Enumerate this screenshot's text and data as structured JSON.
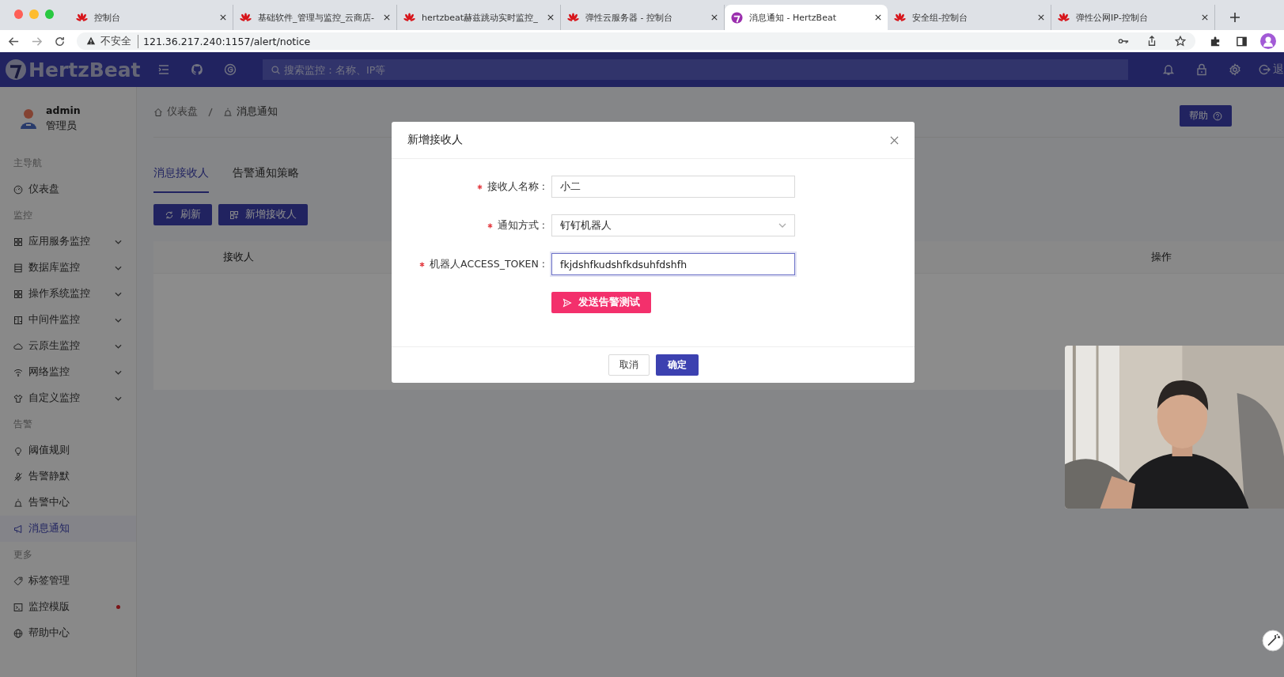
{
  "browser": {
    "tabs": [
      {
        "title": "控制台",
        "selected": false
      },
      {
        "title": "基础软件_管理与监控_云商店-",
        "selected": false
      },
      {
        "title": "hertzbeat赫兹跳动实时监控_",
        "selected": false
      },
      {
        "title": "弹性云服务器 - 控制台",
        "selected": false
      },
      {
        "title": "消息通知 - HertzBeat",
        "selected": true
      },
      {
        "title": "安全组-控制台",
        "selected": false
      },
      {
        "title": "弹性公网IP-控制台",
        "selected": false
      }
    ],
    "address": {
      "security": "不安全",
      "url": "121.36.217.240:1157/alert/notice"
    }
  },
  "header": {
    "logo": "HertzBeat",
    "search_placeholder": "搜索监控：名称、IP等",
    "logout_partial": "退"
  },
  "user": {
    "name": "admin",
    "role": "管理员"
  },
  "sidebar": [
    {
      "title": "主导航",
      "items": [
        {
          "label": "仪表盘",
          "expandable": false,
          "selected": false,
          "dot": false
        }
      ]
    },
    {
      "title": "监控",
      "items": [
        {
          "label": "应用服务监控",
          "expandable": true,
          "selected": false,
          "dot": false
        },
        {
          "label": "数据库监控",
          "expandable": true,
          "selected": false,
          "dot": false
        },
        {
          "label": "操作系统监控",
          "expandable": true,
          "selected": false,
          "dot": false
        },
        {
          "label": "中间件监控",
          "expandable": true,
          "selected": false,
          "dot": false
        },
        {
          "label": "云原生监控",
          "expandable": true,
          "selected": false,
          "dot": false
        },
        {
          "label": "网络监控",
          "expandable": true,
          "selected": false,
          "dot": false
        },
        {
          "label": "自定义监控",
          "expandable": true,
          "selected": false,
          "dot": false
        }
      ]
    },
    {
      "title": "告警",
      "items": [
        {
          "label": "阈值规则",
          "expandable": false,
          "selected": false,
          "dot": false
        },
        {
          "label": "告警静默",
          "expandable": false,
          "selected": false,
          "dot": false
        },
        {
          "label": "告警中心",
          "expandable": false,
          "selected": false,
          "dot": false
        },
        {
          "label": "消息通知",
          "expandable": false,
          "selected": true,
          "dot": false
        }
      ]
    },
    {
      "title": "更多",
      "items": [
        {
          "label": "标签管理",
          "expandable": false,
          "selected": false,
          "dot": false
        },
        {
          "label": "监控模版",
          "expandable": false,
          "selected": false,
          "dot": true
        },
        {
          "label": "帮助中心",
          "expandable": false,
          "selected": false,
          "dot": false
        }
      ]
    }
  ],
  "breadcrumb": [
    "仪表盘",
    "消息通知"
  ],
  "help_button": "帮助",
  "page_tabs": [
    {
      "label": "消息接收人",
      "selected": true
    },
    {
      "label": "告警通知策略",
      "selected": false
    }
  ],
  "toolbar": [
    "刷新",
    "新增接收人"
  ],
  "table": {
    "columns": [
      "接收人",
      "操作"
    ]
  },
  "modal": {
    "title": "新增接收人",
    "fields": [
      {
        "label": "接收人名称 :",
        "required": true,
        "kind": "input",
        "value": "小二",
        "focused": false
      },
      {
        "label": "通知方式 :",
        "required": true,
        "kind": "select",
        "value": "钉钉机器人",
        "focused": false
      },
      {
        "label": "机器人ACCESS_TOKEN :",
        "required": true,
        "kind": "input",
        "value": "fkjdshfkudshfkdsuhfdshfh",
        "focused": true
      }
    ],
    "test_button": "发送告警测试",
    "cancel": "取消",
    "ok": "确定"
  },
  "webcam": {
    "kind": "picture"
  }
}
